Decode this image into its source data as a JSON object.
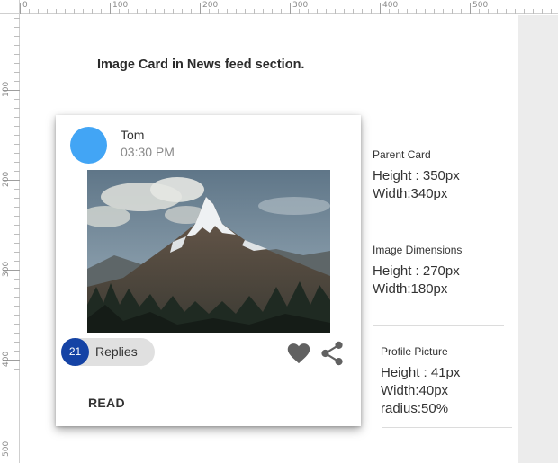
{
  "ruler": {
    "top_labels": [
      "0",
      "100",
      "200",
      "300",
      "400",
      "500"
    ],
    "left_labels": [
      "100",
      "200",
      "300",
      "400",
      "500"
    ]
  },
  "page": {
    "title": "Image Card in News feed section."
  },
  "card": {
    "user_name": "Tom",
    "time": "03:30 PM",
    "avatar_color": "#42a5f5",
    "photo_alt": "Mountain peak landscape",
    "replies_count": "21",
    "replies_label": "Replies",
    "replies_accent": "#1543a5",
    "read_label": "READ",
    "actions": [
      "heart-icon",
      "share-icon"
    ]
  },
  "specs": {
    "parent_card": {
      "caption": "Parent Card",
      "height": "Height : 350px",
      "width": "Width:340px"
    },
    "image_dimensions": {
      "caption": "Image Dimensions",
      "height": "Height : 270px",
      "width": "Width:180px"
    },
    "profile_picture": {
      "caption": "Profile Picture",
      "height": "Height : 41px",
      "width": "Width:40px",
      "radius": "radius:50%"
    }
  }
}
